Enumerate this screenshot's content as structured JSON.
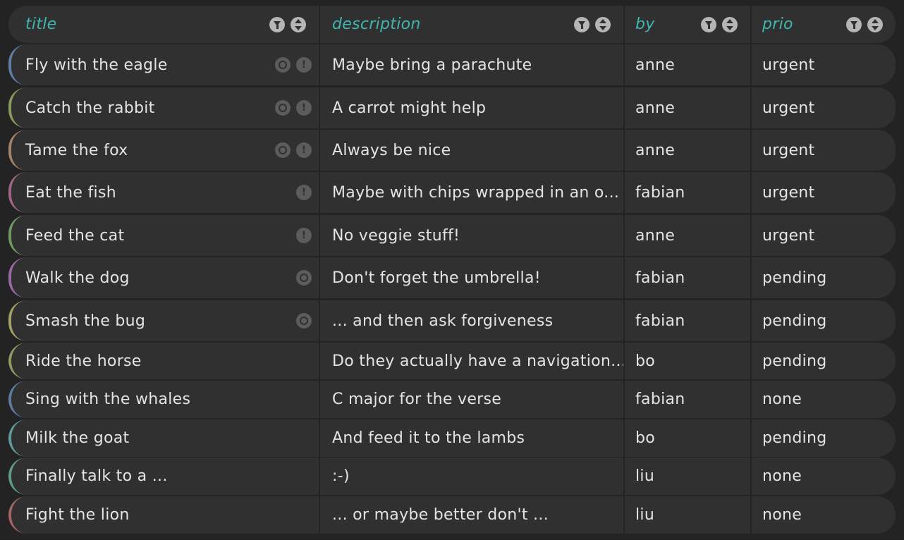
{
  "columns": [
    {
      "key": "title",
      "label": "title"
    },
    {
      "key": "description",
      "label": "description"
    },
    {
      "key": "by",
      "label": "by"
    },
    {
      "key": "prio",
      "label": "prio"
    }
  ],
  "rows": [
    {
      "title": "Fly with the eagle",
      "description": "Maybe bring a parachute",
      "by": "anne",
      "prio": "urgent",
      "accent": "#5f7ea3",
      "clock": true,
      "alert": true
    },
    {
      "title": "Catch the rabbit",
      "description": "A carrot might help",
      "by": "anne",
      "prio": "urgent",
      "accent": "#8a9a5f",
      "clock": true,
      "alert": true
    },
    {
      "title": "Tame the fox",
      "description": "Always be nice",
      "by": "anne",
      "prio": "urgent",
      "accent": "#a3826a",
      "clock": true,
      "alert": true
    },
    {
      "title": "Eat the fish",
      "description": "Maybe with chips wrapped in an o...",
      "by": "fabian",
      "prio": "urgent",
      "accent": "#a06585",
      "clock": false,
      "alert": true
    },
    {
      "title": "Feed the cat",
      "description": "No veggie stuff!",
      "by": "anne",
      "prio": "urgent",
      "accent": "#6f9a5f",
      "clock": false,
      "alert": true
    },
    {
      "title": "Walk the dog",
      "description": "Don't forget the umbrella!",
      "by": "fabian",
      "prio": "pending",
      "accent": "#9a6aa6",
      "clock": true,
      "alert": false
    },
    {
      "title": "Smash the bug",
      "description": "... and then ask forgiveness",
      "by": "fabian",
      "prio": "pending",
      "accent": "#a3a063",
      "clock": true,
      "alert": false
    },
    {
      "title": "Ride the horse",
      "description": "Do they actually have a navigation...",
      "by": "bo",
      "prio": "pending",
      "accent": "#8e9a5f",
      "clock": false,
      "alert": false
    },
    {
      "title": "Sing with the whales",
      "description": "C major for the verse",
      "by": "fabian",
      "prio": "none",
      "accent": "#5f7aa0",
      "clock": false,
      "alert": false
    },
    {
      "title": "Milk the goat",
      "description": "And feed it to the lambs",
      "by": "bo",
      "prio": "pending",
      "accent": "#5f9a9a",
      "clock": false,
      "alert": false
    },
    {
      "title": "Finally talk to a ...",
      "description": ":-)",
      "by": "liu",
      "prio": "none",
      "accent": "#5f9a8a",
      "clock": false,
      "alert": false
    },
    {
      "title": "Fight the lion",
      "description": "... or maybe better don't ...",
      "by": "liu",
      "prio": "none",
      "accent": "#a36565",
      "clock": false,
      "alert": false
    }
  ]
}
